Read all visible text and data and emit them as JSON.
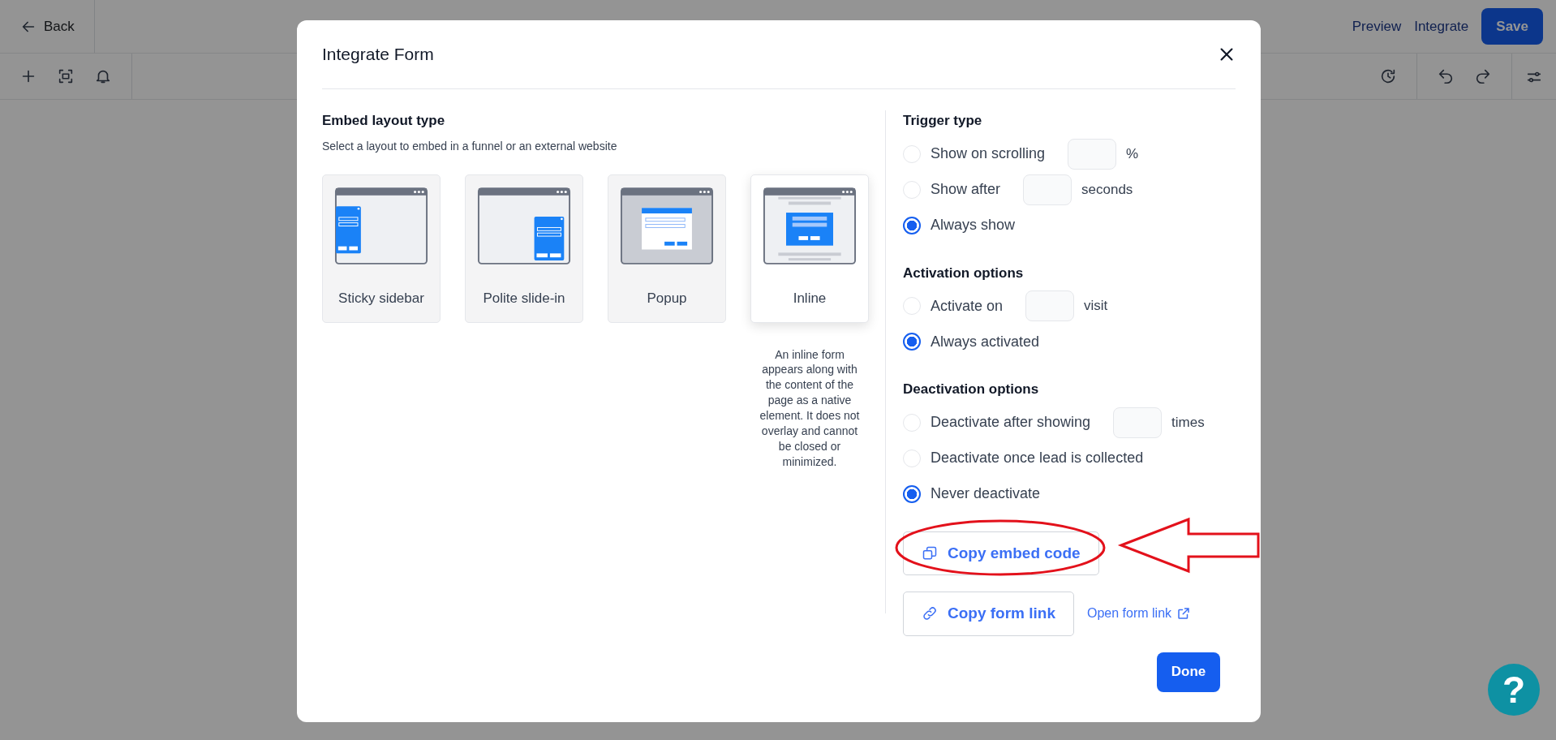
{
  "top_bar": {
    "back": "Back",
    "preview": "Preview",
    "integrate": "Integrate",
    "save": "Save"
  },
  "modal": {
    "title": "Integrate Form",
    "layout_section": {
      "title": "Embed layout type",
      "subtitle": "Select a layout to embed in a funnel or an external website",
      "layouts": [
        {
          "kind": "sticky",
          "label": "Sticky sidebar",
          "selected": false
        },
        {
          "kind": "slidein",
          "label": "Polite slide-in",
          "selected": false
        },
        {
          "kind": "popup",
          "label": "Popup",
          "selected": false
        },
        {
          "kind": "inline",
          "label": "Inline",
          "selected": true
        }
      ],
      "description": "An inline form appears along with the content of the page as a native element. It does not overlay and cannot be closed or minimized."
    },
    "option_groups": [
      {
        "title": "Trigger type",
        "options": [
          {
            "label": "Show on scrolling",
            "selected": false,
            "suffix": "%"
          },
          {
            "label": "Show after",
            "selected": false,
            "suffix": "seconds"
          },
          {
            "label": "Always show",
            "selected": true
          }
        ]
      },
      {
        "title": "Activation options",
        "options": [
          {
            "label": "Activate on",
            "selected": false,
            "suffix": "visit"
          },
          {
            "label": "Always activated",
            "selected": true
          }
        ]
      },
      {
        "title": "Deactivation options",
        "options": [
          {
            "label": "Deactivate after showing",
            "selected": false,
            "suffix": "times"
          },
          {
            "label": "Deactivate once lead is collected",
            "selected": false
          },
          {
            "label": "Never deactivate",
            "selected": true
          }
        ]
      }
    ],
    "copy_embed": "Copy embed code",
    "copy_link": "Copy form link",
    "open_link": "Open form link",
    "done": "Done"
  },
  "help_button": "?"
}
